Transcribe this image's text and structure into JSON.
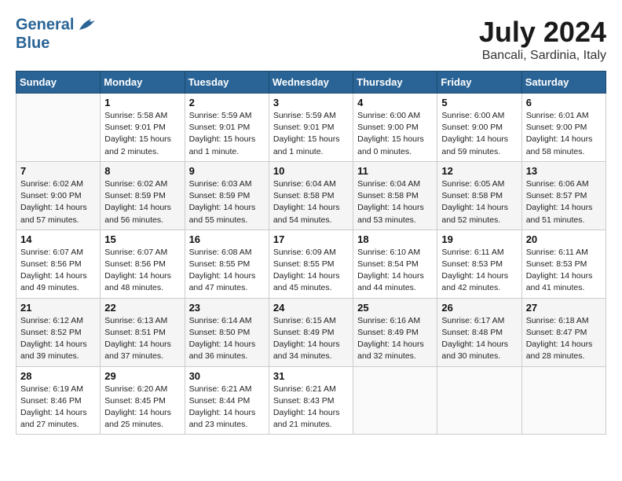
{
  "header": {
    "logo_general": "General",
    "logo_blue": "Blue",
    "month_year": "July 2024",
    "location": "Bancali, Sardinia, Italy"
  },
  "days_of_week": [
    "Sunday",
    "Monday",
    "Tuesday",
    "Wednesday",
    "Thursday",
    "Friday",
    "Saturday"
  ],
  "weeks": [
    [
      {
        "day": "",
        "info": ""
      },
      {
        "day": "1",
        "info": "Sunrise: 5:58 AM\nSunset: 9:01 PM\nDaylight: 15 hours\nand 2 minutes."
      },
      {
        "day": "2",
        "info": "Sunrise: 5:59 AM\nSunset: 9:01 PM\nDaylight: 15 hours\nand 1 minute."
      },
      {
        "day": "3",
        "info": "Sunrise: 5:59 AM\nSunset: 9:01 PM\nDaylight: 15 hours\nand 1 minute."
      },
      {
        "day": "4",
        "info": "Sunrise: 6:00 AM\nSunset: 9:00 PM\nDaylight: 15 hours\nand 0 minutes."
      },
      {
        "day": "5",
        "info": "Sunrise: 6:00 AM\nSunset: 9:00 PM\nDaylight: 14 hours\nand 59 minutes."
      },
      {
        "day": "6",
        "info": "Sunrise: 6:01 AM\nSunset: 9:00 PM\nDaylight: 14 hours\nand 58 minutes."
      }
    ],
    [
      {
        "day": "7",
        "info": "Sunrise: 6:02 AM\nSunset: 9:00 PM\nDaylight: 14 hours\nand 57 minutes."
      },
      {
        "day": "8",
        "info": "Sunrise: 6:02 AM\nSunset: 8:59 PM\nDaylight: 14 hours\nand 56 minutes."
      },
      {
        "day": "9",
        "info": "Sunrise: 6:03 AM\nSunset: 8:59 PM\nDaylight: 14 hours\nand 55 minutes."
      },
      {
        "day": "10",
        "info": "Sunrise: 6:04 AM\nSunset: 8:58 PM\nDaylight: 14 hours\nand 54 minutes."
      },
      {
        "day": "11",
        "info": "Sunrise: 6:04 AM\nSunset: 8:58 PM\nDaylight: 14 hours\nand 53 minutes."
      },
      {
        "day": "12",
        "info": "Sunrise: 6:05 AM\nSunset: 8:58 PM\nDaylight: 14 hours\nand 52 minutes."
      },
      {
        "day": "13",
        "info": "Sunrise: 6:06 AM\nSunset: 8:57 PM\nDaylight: 14 hours\nand 51 minutes."
      }
    ],
    [
      {
        "day": "14",
        "info": "Sunrise: 6:07 AM\nSunset: 8:56 PM\nDaylight: 14 hours\nand 49 minutes."
      },
      {
        "day": "15",
        "info": "Sunrise: 6:07 AM\nSunset: 8:56 PM\nDaylight: 14 hours\nand 48 minutes."
      },
      {
        "day": "16",
        "info": "Sunrise: 6:08 AM\nSunset: 8:55 PM\nDaylight: 14 hours\nand 47 minutes."
      },
      {
        "day": "17",
        "info": "Sunrise: 6:09 AM\nSunset: 8:55 PM\nDaylight: 14 hours\nand 45 minutes."
      },
      {
        "day": "18",
        "info": "Sunrise: 6:10 AM\nSunset: 8:54 PM\nDaylight: 14 hours\nand 44 minutes."
      },
      {
        "day": "19",
        "info": "Sunrise: 6:11 AM\nSunset: 8:53 PM\nDaylight: 14 hours\nand 42 minutes."
      },
      {
        "day": "20",
        "info": "Sunrise: 6:11 AM\nSunset: 8:53 PM\nDaylight: 14 hours\nand 41 minutes."
      }
    ],
    [
      {
        "day": "21",
        "info": "Sunrise: 6:12 AM\nSunset: 8:52 PM\nDaylight: 14 hours\nand 39 minutes."
      },
      {
        "day": "22",
        "info": "Sunrise: 6:13 AM\nSunset: 8:51 PM\nDaylight: 14 hours\nand 37 minutes."
      },
      {
        "day": "23",
        "info": "Sunrise: 6:14 AM\nSunset: 8:50 PM\nDaylight: 14 hours\nand 36 minutes."
      },
      {
        "day": "24",
        "info": "Sunrise: 6:15 AM\nSunset: 8:49 PM\nDaylight: 14 hours\nand 34 minutes."
      },
      {
        "day": "25",
        "info": "Sunrise: 6:16 AM\nSunset: 8:49 PM\nDaylight: 14 hours\nand 32 minutes."
      },
      {
        "day": "26",
        "info": "Sunrise: 6:17 AM\nSunset: 8:48 PM\nDaylight: 14 hours\nand 30 minutes."
      },
      {
        "day": "27",
        "info": "Sunrise: 6:18 AM\nSunset: 8:47 PM\nDaylight: 14 hours\nand 28 minutes."
      }
    ],
    [
      {
        "day": "28",
        "info": "Sunrise: 6:19 AM\nSunset: 8:46 PM\nDaylight: 14 hours\nand 27 minutes."
      },
      {
        "day": "29",
        "info": "Sunrise: 6:20 AM\nSunset: 8:45 PM\nDaylight: 14 hours\nand 25 minutes."
      },
      {
        "day": "30",
        "info": "Sunrise: 6:21 AM\nSunset: 8:44 PM\nDaylight: 14 hours\nand 23 minutes."
      },
      {
        "day": "31",
        "info": "Sunrise: 6:21 AM\nSunset: 8:43 PM\nDaylight: 14 hours\nand 21 minutes."
      },
      {
        "day": "",
        "info": ""
      },
      {
        "day": "",
        "info": ""
      },
      {
        "day": "",
        "info": ""
      }
    ]
  ]
}
